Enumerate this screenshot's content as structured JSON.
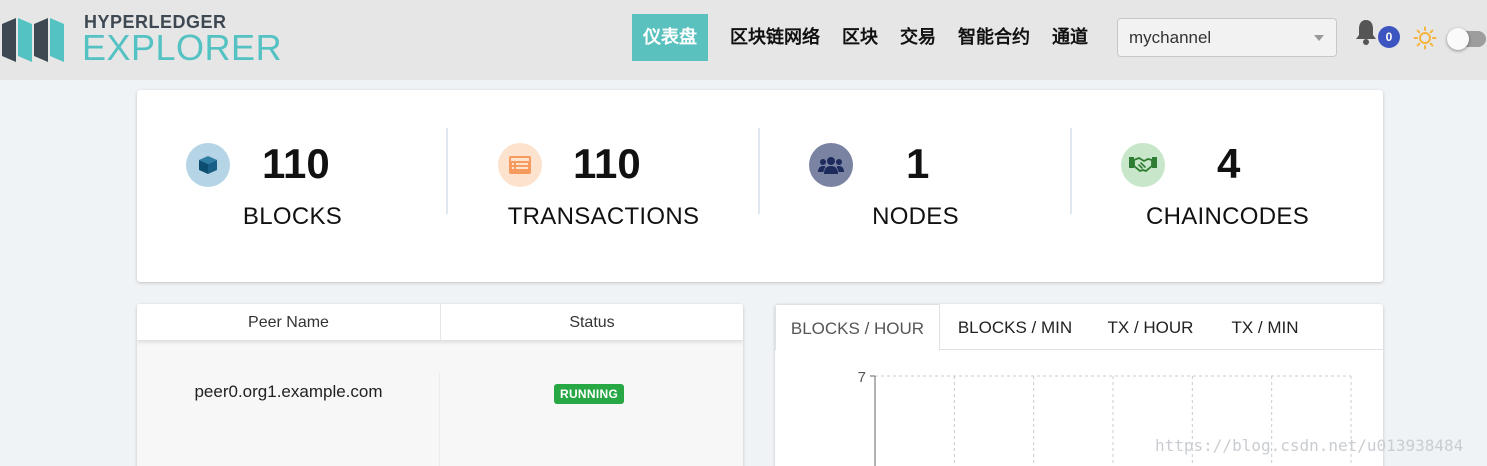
{
  "brand": {
    "line1": "HYPERLEDGER",
    "line2": "EXPLORER",
    "colors": {
      "dark": "#3d4852",
      "teal": "#54c2c2"
    }
  },
  "nav": {
    "items": [
      {
        "label": "仪表盘",
        "active": true
      },
      {
        "label": "区块链网络"
      },
      {
        "label": "区块"
      },
      {
        "label": "交易"
      },
      {
        "label": "智能合约"
      },
      {
        "label": "通道"
      }
    ],
    "accent": "#5bc1be"
  },
  "channel_select": {
    "value": "mychannel"
  },
  "notifications": {
    "count": "0",
    "icon": "bell-icon"
  },
  "theme": {
    "icon": "sun-icon"
  },
  "stats": [
    {
      "value": "110",
      "label": "BLOCKS",
      "icon": "cube-icon",
      "bg": "#b5d5e6",
      "fg": "#0b4e72"
    },
    {
      "value": "110",
      "label": "TRANSACTIONS",
      "icon": "list-icon",
      "bg": "#fde3ce",
      "fg": "#f79a5d"
    },
    {
      "value": "1",
      "label": "NODES",
      "icon": "users-icon",
      "bg": "#7b83a3",
      "fg": "#1d2a5c"
    },
    {
      "value": "4",
      "label": "CHAINCODES",
      "icon": "handshake-icon",
      "bg": "#c8e6c9",
      "fg": "#2e7d32"
    }
  ],
  "peers": {
    "columns": [
      "Peer Name",
      "Status"
    ],
    "rows": [
      {
        "name": "peer0.org1.example.com",
        "status": "RUNNING"
      }
    ]
  },
  "chart": {
    "tabs": [
      {
        "label": "BLOCKS / HOUR",
        "active": true
      },
      {
        "label": "BLOCKS / MIN"
      },
      {
        "label": "TX / HOUR"
      },
      {
        "label": "TX / MIN"
      }
    ]
  },
  "chart_data": {
    "type": "line",
    "title": "",
    "xlabel": "",
    "ylabel": "",
    "y_ticks": [
      "7"
    ],
    "ylim": [
      0,
      7
    ],
    "grid": true,
    "series": []
  },
  "watermark": "https://blog.csdn.net/u013938484"
}
